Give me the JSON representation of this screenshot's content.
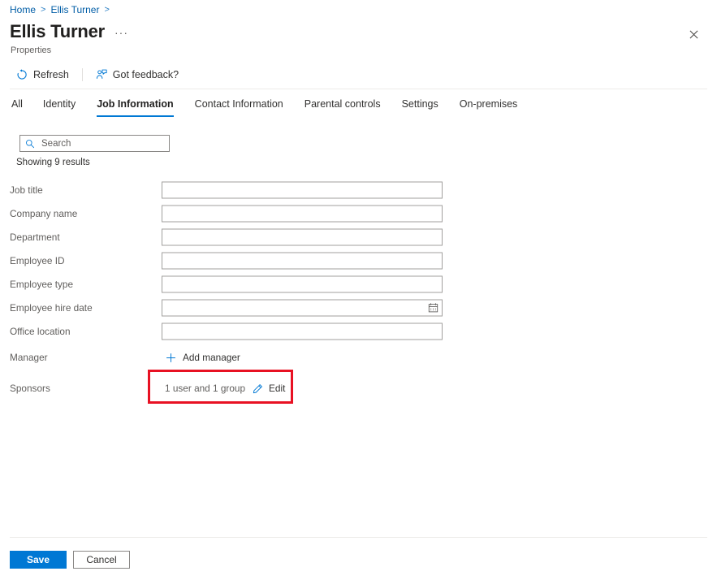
{
  "breadcrumb": {
    "items": [
      {
        "label": "Home"
      },
      {
        "label": "Ellis Turner"
      }
    ],
    "separator": ">"
  },
  "header": {
    "title": "Ellis Turner",
    "more_menu": "···",
    "subtitle": "Properties",
    "close_icon": "close-icon"
  },
  "command_bar": {
    "refresh_label": "Refresh",
    "feedback_label": "Got feedback?"
  },
  "tabs": [
    {
      "label": "All",
      "active": false
    },
    {
      "label": "Identity",
      "active": false
    },
    {
      "label": "Job Information",
      "active": true
    },
    {
      "label": "Contact Information",
      "active": false
    },
    {
      "label": "Parental controls",
      "active": false
    },
    {
      "label": "Settings",
      "active": false
    },
    {
      "label": "On-premises",
      "active": false
    }
  ],
  "search": {
    "placeholder": "Search",
    "value": ""
  },
  "results_text": "Showing 9 results",
  "fields": [
    {
      "label": "Job title",
      "type": "text",
      "value": ""
    },
    {
      "label": "Company name",
      "type": "text",
      "value": ""
    },
    {
      "label": "Department",
      "type": "text",
      "value": ""
    },
    {
      "label": "Employee ID",
      "type": "text",
      "value": ""
    },
    {
      "label": "Employee type",
      "type": "text",
      "value": ""
    },
    {
      "label": "Employee hire date",
      "type": "date",
      "value": ""
    },
    {
      "label": "Office location",
      "type": "text",
      "value": ""
    }
  ],
  "manager": {
    "label": "Manager",
    "action_label": "Add manager"
  },
  "sponsors": {
    "label": "Sponsors",
    "summary": "1 user and 1 group",
    "edit_label": "Edit",
    "highlight_color": "#e81123"
  },
  "footer": {
    "save_label": "Save",
    "cancel_label": "Cancel"
  },
  "colors": {
    "accent": "#0078d4",
    "link": "#005da6",
    "label": "#605e5c",
    "highlight": "#e81123"
  }
}
